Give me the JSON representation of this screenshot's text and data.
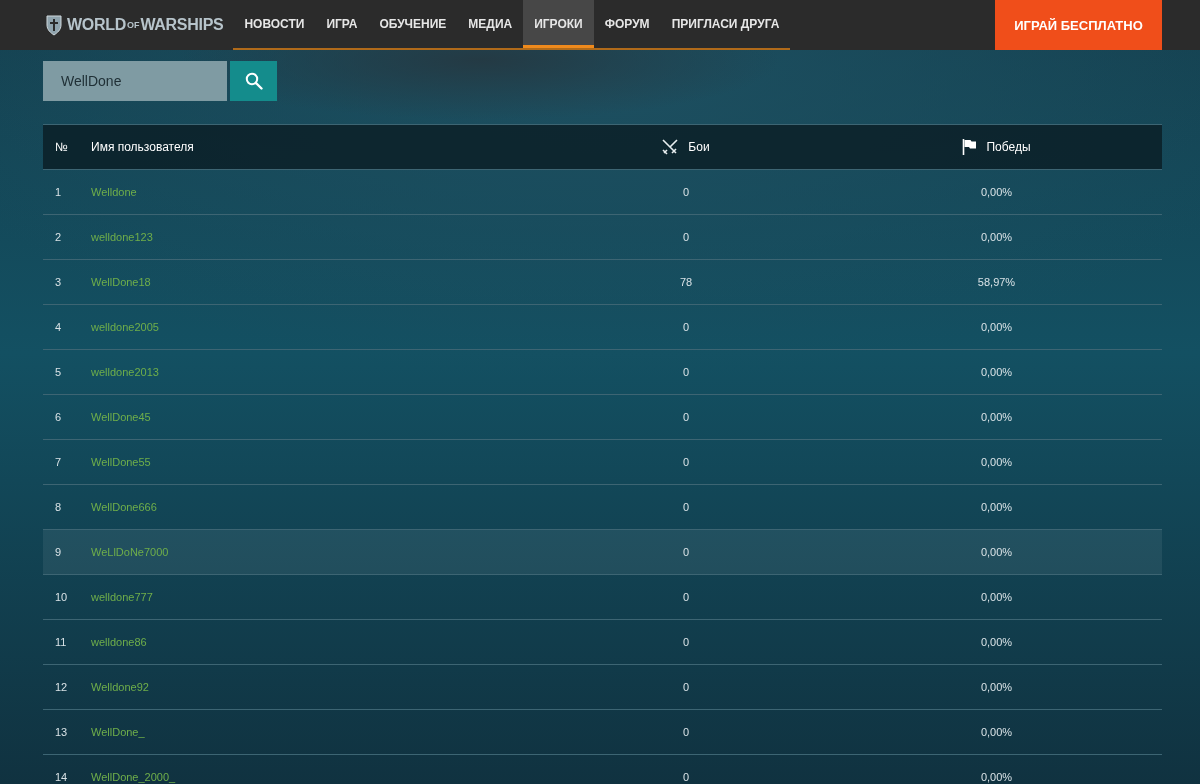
{
  "header": {
    "logo": {
      "part_1": "WORLD",
      "part_2": "OF",
      "part_3": "WARSHIPS"
    },
    "nav": [
      {
        "label": "НОВОСТИ",
        "selected": false
      },
      {
        "label": "ИГРА",
        "selected": false
      },
      {
        "label": "ОБУЧЕНИЕ",
        "selected": false
      },
      {
        "label": "МЕДИА",
        "selected": false
      },
      {
        "label": "ИГРОКИ",
        "selected": true
      },
      {
        "label": "ФОРУМ",
        "selected": false
      },
      {
        "label": "ПРИГЛАСИ ДРУГА",
        "selected": false
      }
    ],
    "play_button": "ИГРАЙ БЕСПЛАТНО"
  },
  "search": {
    "value": "WellDone"
  },
  "table": {
    "columns": [
      "№",
      "Имя пользователя",
      "Бои",
      "Победы"
    ],
    "rows": [
      {
        "number": "1",
        "name": "Welldone",
        "battles": "0",
        "wins": "0,00%",
        "selected": false
      },
      {
        "number": "2",
        "name": "welldone123",
        "battles": "0",
        "wins": "0,00%",
        "selected": false
      },
      {
        "number": "3",
        "name": "WellDone18",
        "battles": "78",
        "wins": "58,97%",
        "selected": false
      },
      {
        "number": "4",
        "name": "welldone2005",
        "battles": "0",
        "wins": "0,00%",
        "selected": false
      },
      {
        "number": "5",
        "name": "welldone2013",
        "battles": "0",
        "wins": "0,00%",
        "selected": false
      },
      {
        "number": "6",
        "name": "WellDone45",
        "battles": "0",
        "wins": "0,00%",
        "selected": false
      },
      {
        "number": "7",
        "name": "WellDone55",
        "battles": "0",
        "wins": "0,00%",
        "selected": false
      },
      {
        "number": "8",
        "name": "WellDone666",
        "battles": "0",
        "wins": "0,00%",
        "selected": false
      },
      {
        "number": "9",
        "name": "WeLlDoNe7000",
        "battles": "0",
        "wins": "0,00%",
        "selected": true
      },
      {
        "number": "10",
        "name": "welldone777",
        "battles": "0",
        "wins": "0,00%",
        "selected": false
      },
      {
        "number": "11",
        "name": "welldone86",
        "battles": "0",
        "wins": "0,00%",
        "selected": false
      },
      {
        "number": "12",
        "name": "Welldone92",
        "battles": "0",
        "wins": "0,00%",
        "selected": false
      },
      {
        "number": "13",
        "name": "WellDone_",
        "battles": "0",
        "wins": "0,00%",
        "selected": false
      },
      {
        "number": "14",
        "name": "WellDone_2000_",
        "battles": "0",
        "wins": "0,00%",
        "selected": false
      }
    ]
  }
}
